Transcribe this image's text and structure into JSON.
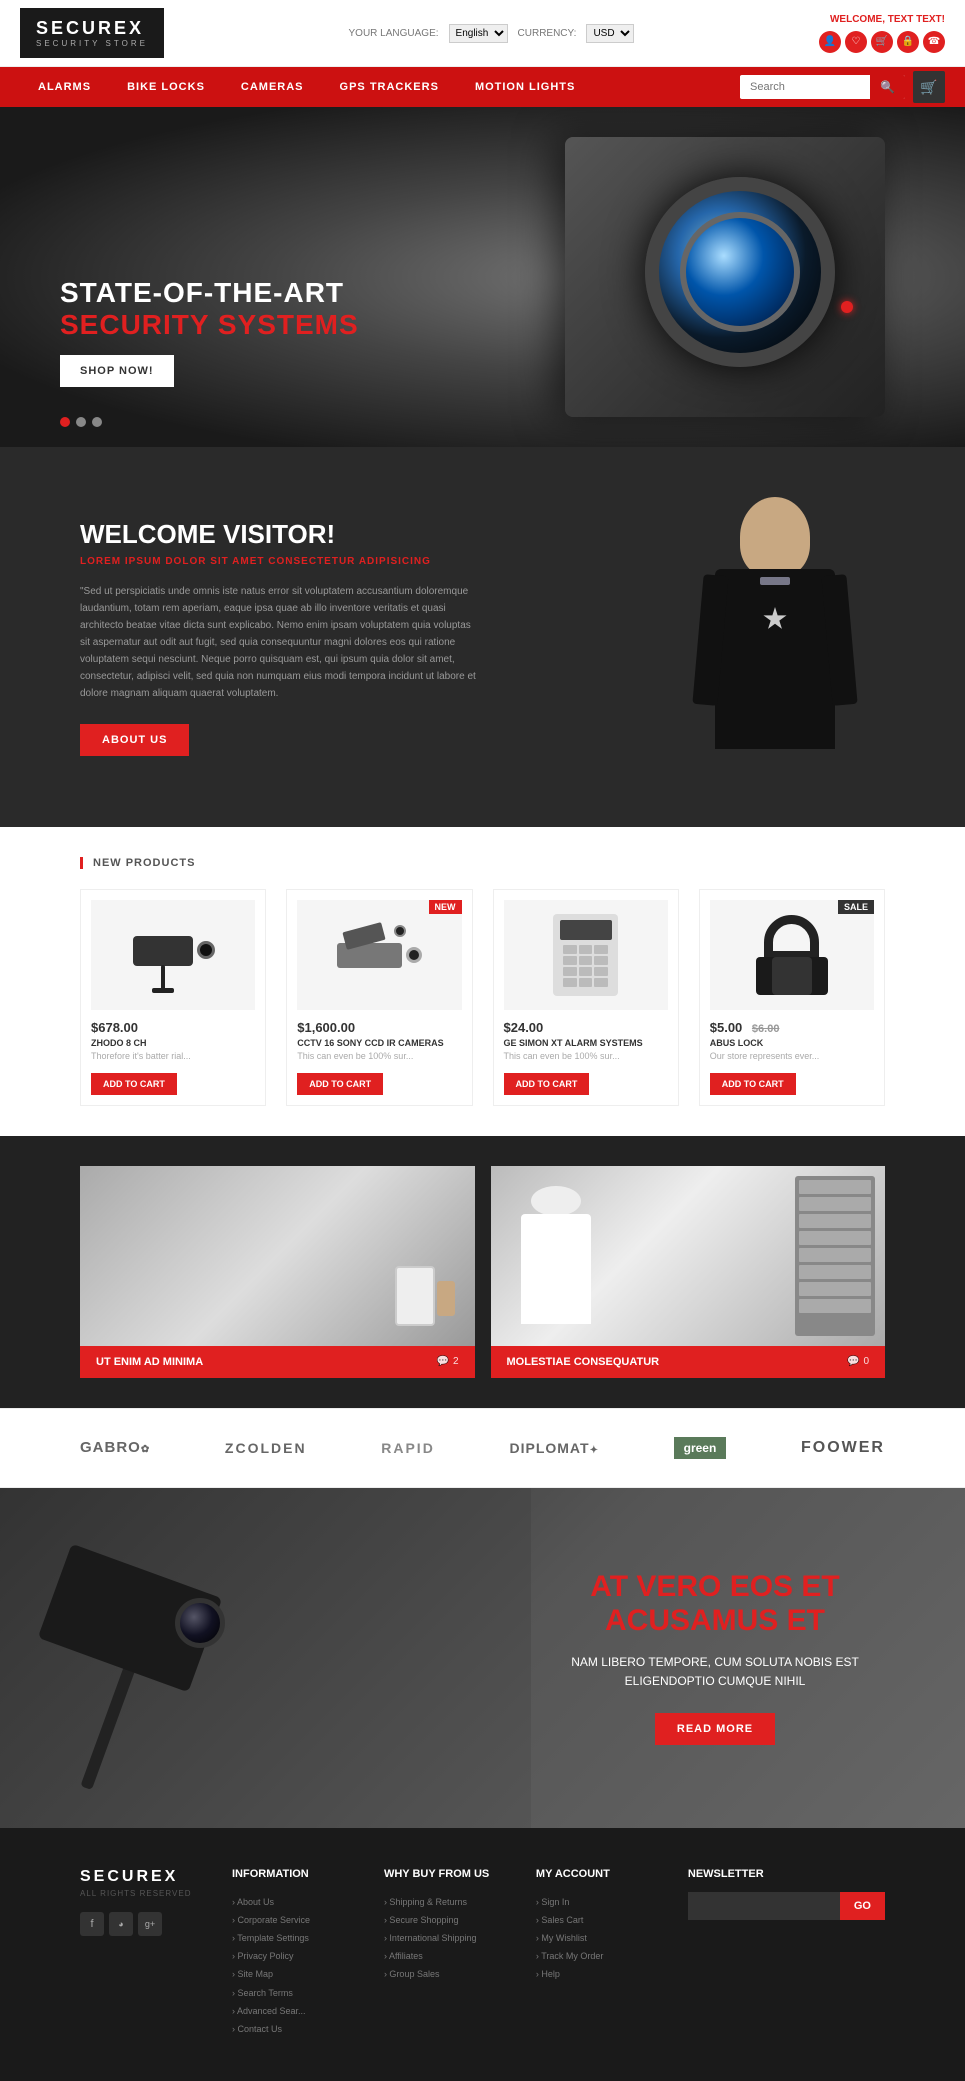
{
  "header": {
    "logo_main": "SECUREX",
    "logo_sub": "SECURITY STORE",
    "welcome_text": "WELCOME, TEXT TEXT!",
    "lang_label": "YOUR LANGUAGE:",
    "lang_value": "English",
    "currency_label": "CURRENCY:",
    "currency_value": "USD"
  },
  "nav": {
    "items": [
      {
        "label": "ALARMS"
      },
      {
        "label": "BIKE LOCKS"
      },
      {
        "label": "CAMERAS"
      },
      {
        "label": "GPS TRACKERS"
      },
      {
        "label": "MOTION LIGHTS"
      }
    ],
    "search_placeholder": "Search"
  },
  "hero": {
    "title1": "STATE-OF-THE-ART",
    "title2": "SECURITY SYSTEMS",
    "cta": "SHOP NOW!"
  },
  "welcome": {
    "title": "WELCOME VISITOR!",
    "subtitle": "LOREM IPSUM DOLOR SIT AMET CONSECTETUR ADIPISICING",
    "body": "\"Sed ut perspiciatis unde omnis iste natus error sit voluptatem accusantium doloremque laudantium, totam rem aperiam, eaque ipsa quae ab illo inventore veritatis et quasi architecto beatae vitae dicta sunt explicabo. Nemo enim ipsam voluptatem quia voluptas sit aspernatur aut odit aut fugit, sed quia consequuntur magni dolores eos qui ratione voluptatem sequi nesciunt. Neque porro quisquam est, qui ipsum quia dolor sit amet, consectetur, adipisci velit, sed quia non numquam eius modi tempora incidunt ut labore et dolore magnam aliquam quaerat voluptatem.",
    "about_btn": "ABOUT US"
  },
  "products": {
    "section_label": "NEW PRODUCTS",
    "items": [
      {
        "price": "$678.00",
        "price_orig": "",
        "name": "ZHODO 8 CH",
        "desc": "Thorefore it's batter rial...",
        "badge": "",
        "add_btn": "ADD TO CART"
      },
      {
        "price": "$1,600.00",
        "price_orig": "",
        "name": "CCTV 16 SONY CCD IR CAMERAS",
        "desc": "This can even be 100% sur...",
        "badge": "NEW",
        "add_btn": "ADD TO CART"
      },
      {
        "price": "$24.00",
        "price_orig": "",
        "name": "GE SIMON XT ALARM SYSTEMS",
        "desc": "This can even be 100% sur...",
        "badge": "",
        "add_btn": "ADD TO CART"
      },
      {
        "price": "$5.00",
        "price_orig": "$6.00",
        "name": "ABUS LOCK",
        "desc": "Our store represents ever...",
        "badge": "SALE",
        "add_btn": "ADD TO CART"
      }
    ]
  },
  "blog": {
    "posts": [
      {
        "title": "UT ENIM AD MINIMA",
        "comments": "2"
      },
      {
        "title": "MOLESTIAE CONSEQUATUR",
        "comments": "0"
      }
    ]
  },
  "brands": [
    "GABRO",
    "ZCOLDEN",
    "RAPID",
    "DIPLOMAT",
    "green",
    "FOOWER"
  ],
  "cta": {
    "title": "AT VERO EOS ET ACUSAMUS ET",
    "subtitle": "NAM LIBERO TEMPORE, CUM SOLUTA NOBIS EST ELIGENDOPTIO CUMQUE NIHIL",
    "btn": "READ MORE"
  },
  "footer": {
    "brand": "SECUREX",
    "copyright": "ALL RIGHTS RESERVED",
    "columns": [
      {
        "title": "Information",
        "links": [
          "About Us",
          "Corporate Service",
          "Template Settings",
          "Privacy Policy",
          "Site Map",
          "Search Terms",
          "Advanced Sear...",
          "Contact Us"
        ]
      },
      {
        "title": "Why buy from us",
        "links": [
          "Shipping & Returns",
          "Secure Shopping",
          "International Shipping",
          "Affiliates",
          "Group Sales"
        ]
      },
      {
        "title": "My account",
        "links": [
          "Sign In",
          "Sales Cart",
          "My Wishlist",
          "Track My Order",
          "Help"
        ]
      },
      {
        "title": "Newsletter",
        "input_placeholder": "",
        "go_btn": "GO"
      }
    ]
  }
}
